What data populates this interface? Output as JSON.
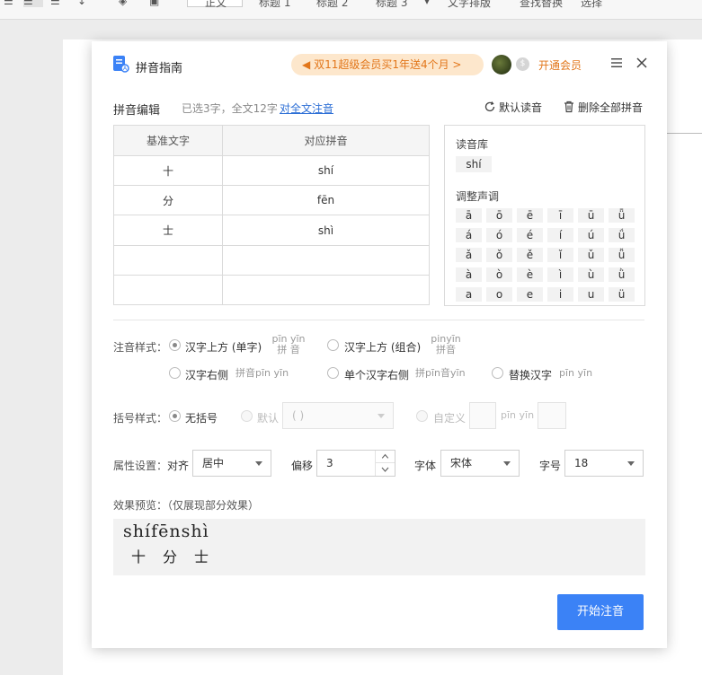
{
  "toolbar": {
    "style_normal": "正文",
    "heading1": "标题 1",
    "heading2": "标题 2",
    "heading3": "标题 3",
    "text_layout": "文字排版",
    "find_replace": "查找替换",
    "select": "选择"
  },
  "dialog": {
    "title": "拼音指南",
    "promo": "双11超级会员买1年送4个月 >",
    "vip_label": "开通会员",
    "editor": {
      "section_title": "拼音编辑",
      "selection_info": "已选3字，全文12字",
      "annotate_all_link": "对全文注音",
      "default_reading_label": "默认读音",
      "delete_all_label": "删除全部拼音"
    },
    "table": {
      "headers": [
        "基准文字",
        "对应拼音"
      ],
      "rows": [
        {
          "char": "十",
          "pinyin": "shí"
        },
        {
          "char": "分",
          "pinyin": "fēn"
        },
        {
          "char": "士",
          "pinyin": "shì"
        },
        {
          "char": "",
          "pinyin": ""
        },
        {
          "char": "",
          "pinyin": ""
        }
      ]
    },
    "reading_library": {
      "label": "读音库",
      "items": [
        "shí"
      ]
    },
    "tone_adjust": {
      "label": "调整声调",
      "grid": [
        [
          "ā",
          "ō",
          "ē",
          "ī",
          "ū",
          "ǖ"
        ],
        [
          "á",
          "ó",
          "é",
          "í",
          "ú",
          "ǘ"
        ],
        [
          "ǎ",
          "ǒ",
          "ě",
          "ǐ",
          "ǔ",
          "ǚ"
        ],
        [
          "à",
          "ò",
          "è",
          "ì",
          "ù",
          "ǜ"
        ],
        [
          "a",
          "o",
          "e",
          "i",
          "u",
          "ü"
        ]
      ]
    },
    "annotation_style": {
      "label": "注音样式：",
      "options": [
        {
          "label": "汉字上方 (单字)",
          "sample_top": "pīn yīn",
          "sample_bottom": "拼 音",
          "checked": true
        },
        {
          "label": "汉字上方 (组合)",
          "sample_top": "pinyīn",
          "sample_bottom": "拼音",
          "checked": false
        },
        {
          "label": "汉字右侧",
          "sample": "拼音pīn yīn",
          "checked": false
        },
        {
          "label": "单个汉字右侧",
          "sample": "拼pīn音yīn",
          "checked": false
        },
        {
          "label": "替换汉字",
          "sample": "pīn yīn",
          "checked": false
        }
      ]
    },
    "bracket_style": {
      "label": "括号样式：",
      "no_bracket": "无括号",
      "default": "默认",
      "default_value": "( )",
      "custom": "自定义",
      "custom_sample": "pīn yīn"
    },
    "properties": {
      "label": "属性设置：",
      "align_label": "对齐",
      "align_value": "居中",
      "offset_label": "偏移",
      "offset_value": "3",
      "font_label": "字体",
      "font_value": "宋体",
      "size_label": "字号",
      "size_value": "18"
    },
    "preview": {
      "label": "效果预览：（仅展现部分效果）",
      "pinyin": "shífēnshì",
      "chars": [
        "十",
        "分",
        "士"
      ]
    },
    "start_button": "开始注音"
  }
}
